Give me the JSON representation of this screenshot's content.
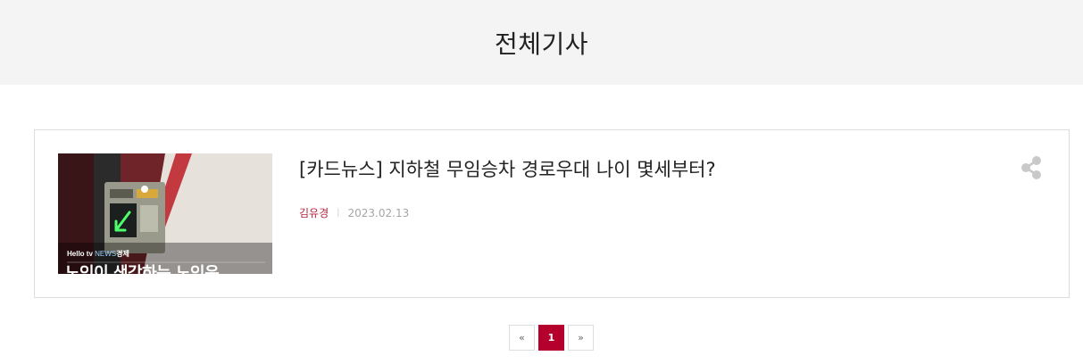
{
  "page": {
    "title": "전체기사"
  },
  "article": {
    "title": "[카드뉴스] 지하철 무임승차 경로우대 나이 몇세부터?",
    "author": "김유경",
    "separator": "|",
    "date": "2023.02.13",
    "thumbnail": {
      "brand": "Hello tv",
      "brand_news": "NEWS",
      "brand_section": "경제",
      "headline": "노인이 생각하는 노인은"
    },
    "share_icon": "share-icon"
  },
  "pagination": {
    "prev_label": "«",
    "current_page": "1",
    "next_label": "»"
  },
  "colors": {
    "header_bg": "#f4f4f4",
    "accent": "#b5002e",
    "author": "#b3263e"
  }
}
